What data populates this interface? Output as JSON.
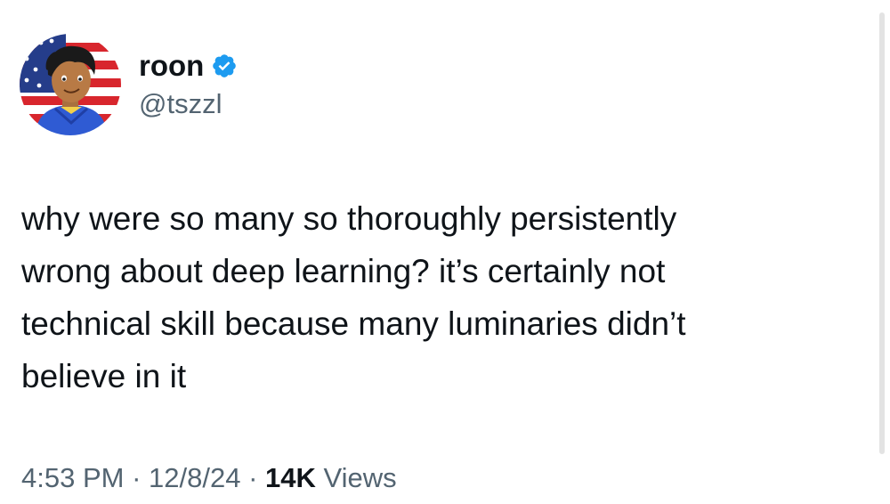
{
  "user": {
    "display_name": "roon",
    "handle": "@tszzl",
    "verified": true,
    "badge_color": "#1d9bf0"
  },
  "tweet": {
    "text": "why were so many so thoroughly persistently\nwrong about deep learning? it’s certainly not\ntechnical skill because many luminaries didn’t\nbelieve in it"
  },
  "meta": {
    "time": "4:53 PM",
    "separator": "·",
    "date": "12/8/24",
    "views_count": "14K",
    "views_label": "Views"
  },
  "colors": {
    "text_primary": "#0f1419",
    "text_secondary": "#536471",
    "background": "#ffffff"
  },
  "icons": {
    "avatar": "cartoon-avatar-with-flag",
    "badge": "verified-badge-icon"
  }
}
